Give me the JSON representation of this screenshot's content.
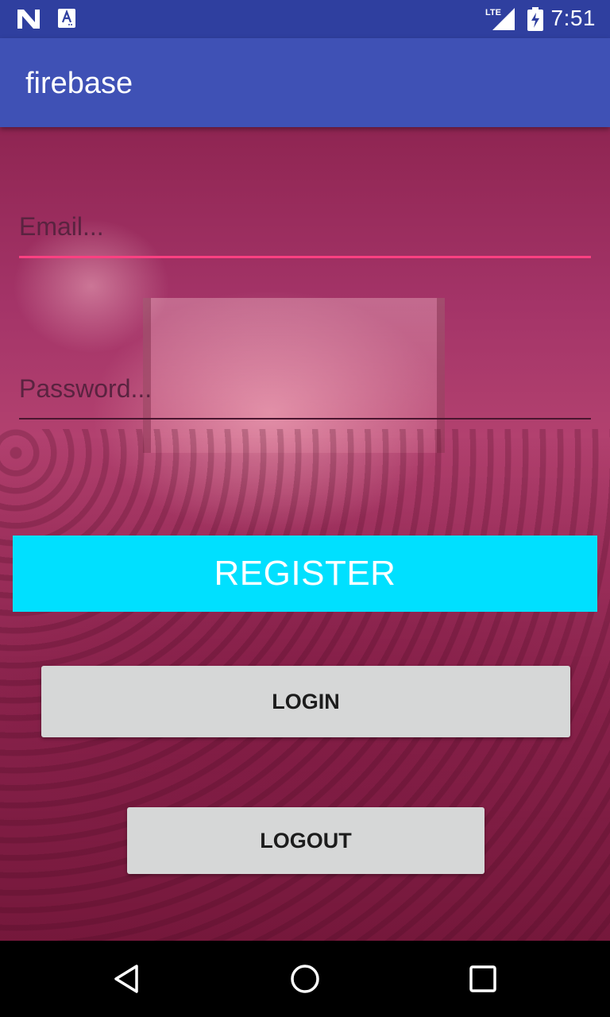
{
  "status_bar": {
    "time": "7:51",
    "icons": [
      "n-notification-icon",
      "a-notification-icon",
      "lte-signal-icon",
      "battery-charging-icon"
    ]
  },
  "app_bar": {
    "title": "firebase",
    "color": "#3f51b5"
  },
  "form": {
    "email_placeholder": "Email...",
    "email_value": "",
    "password_placeholder": "Password...",
    "password_value": "",
    "accent_color": "#ff4081"
  },
  "buttons": {
    "register_label": "REGISTER",
    "register_color": "#00e0ff",
    "login_label": "LOGIN",
    "logout_label": "LOGOUT"
  },
  "nav_bar": {
    "icons": [
      "back-icon",
      "home-icon",
      "recents-icon"
    ]
  }
}
